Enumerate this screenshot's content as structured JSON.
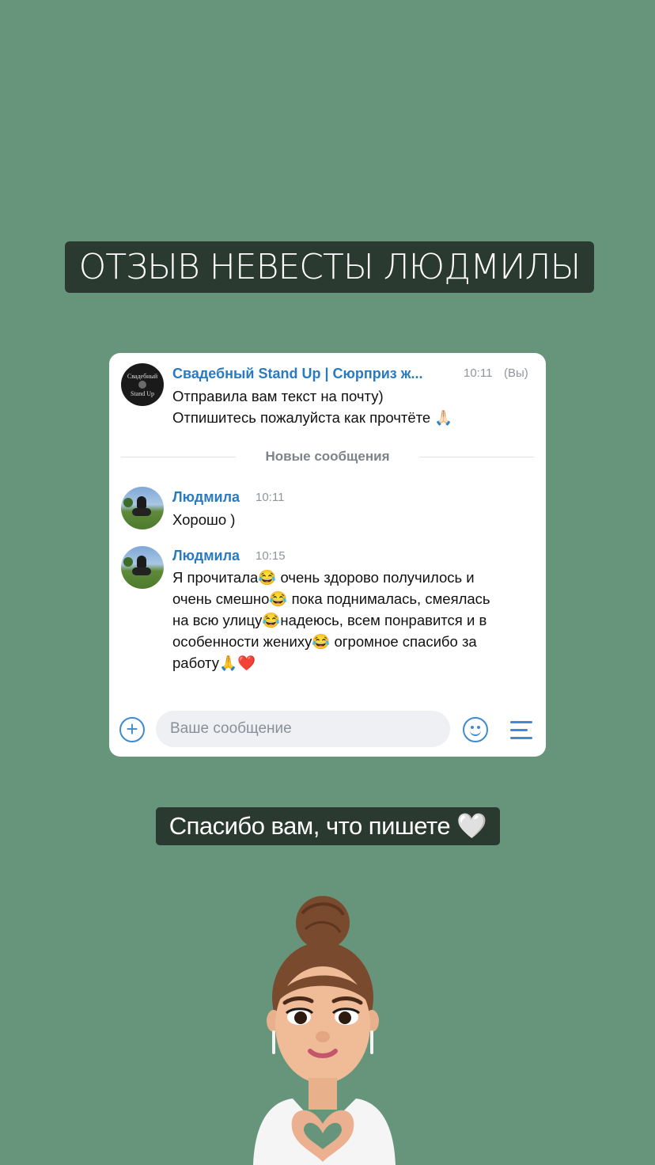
{
  "story": {
    "title": "ОТЗЫВ НЕВЕСТЫ ЛЮДМИЛЫ",
    "caption": "Спасибо вам, что пишете 🤍"
  },
  "chat": {
    "messages": [
      {
        "author": "Свадебный Stand Up | Сюрприз ж...",
        "time": "10:11",
        "you_label": "(Вы)",
        "avatar_text_top": "Свадебный",
        "avatar_text_bottom": "Stand Up",
        "lines": [
          "Отправила вам текст на почту)",
          "Отпишитесь пожалуйста как прочтёте 🙏🏻"
        ]
      },
      {
        "author": "Людмила",
        "time": "10:11",
        "lines": [
          "Хорошо )"
        ]
      },
      {
        "author": "Людмила",
        "time": "10:15",
        "lines": [
          "Я прочитала😂 очень здорово получилось и",
          "очень смешно😂 пока поднималась, смеялась",
          "на всю улицу😂надеюсь, всем понравится и в",
          "особенности жениху😂 огромное спасибо за",
          "работу🙏❤️"
        ]
      }
    ],
    "divider_label": "Новые сообщения",
    "composer": {
      "placeholder": "Ваше сообщение",
      "add_icon": "plus-circle-icon",
      "emoji_icon": "smile-icon",
      "menu_icon": "menu-lines-icon"
    }
  },
  "colors": {
    "background": "#66957b",
    "label_bg": "#2b3a30",
    "link": "#2a7ac0",
    "accent": "#3f8ad2"
  }
}
